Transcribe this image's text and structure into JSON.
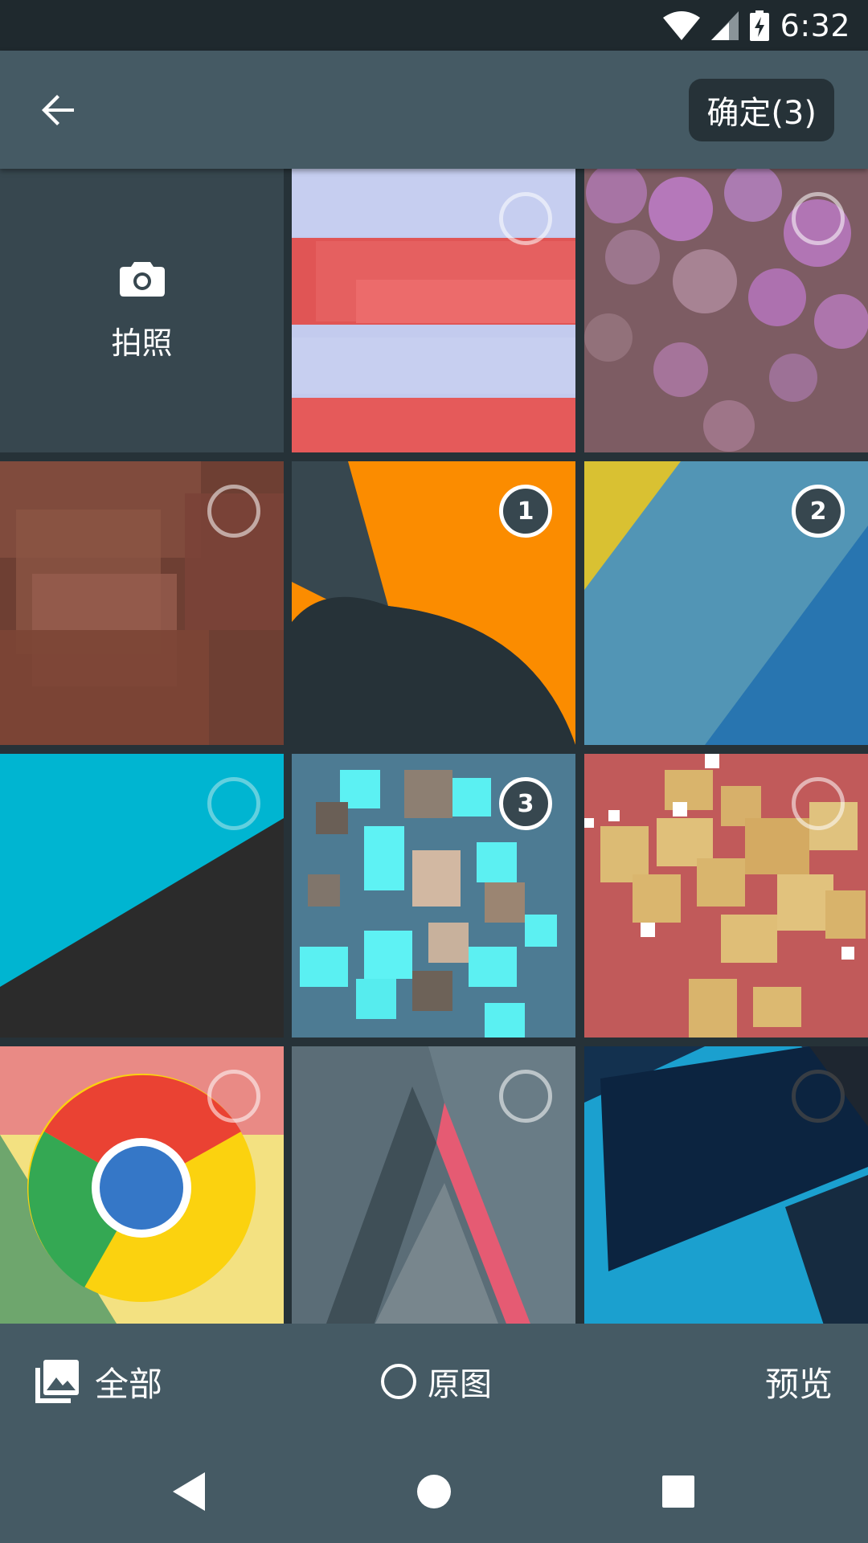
{
  "status_bar": {
    "time": "6:32",
    "icons": [
      "wifi-icon",
      "cell-signal-icon",
      "battery-charging-icon"
    ]
  },
  "app_bar": {
    "back_icon": "arrow-left-icon",
    "confirm_label": "确定(3)"
  },
  "grid": {
    "camera": {
      "icon": "camera-icon",
      "label": "拍照"
    },
    "items": [
      {
        "selected": false,
        "order": ""
      },
      {
        "selected": false,
        "order": ""
      },
      {
        "selected": false,
        "order": ""
      },
      {
        "selected": true,
        "order": "1"
      },
      {
        "selected": true,
        "order": "2"
      },
      {
        "selected": false,
        "order": ""
      },
      {
        "selected": true,
        "order": "3"
      },
      {
        "selected": false,
        "order": ""
      },
      {
        "selected": false,
        "order": ""
      },
      {
        "selected": false,
        "order": ""
      },
      {
        "selected": false,
        "order": ""
      }
    ]
  },
  "bottom_bar": {
    "folder_label": "全部",
    "original_label": "原图",
    "preview_label": "预览"
  },
  "colors": {
    "app_bar": "#455a64",
    "background": "#263238",
    "status_bar": "#1f292e",
    "camera_tile": "#37474f"
  }
}
